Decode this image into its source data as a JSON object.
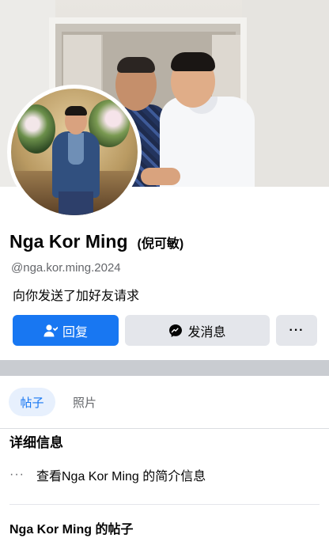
{
  "profile": {
    "name": "Nga Kor Ming",
    "alt_name": "(倪可敏)",
    "handle": "@nga.kor.ming.2024",
    "friend_request_text": "向你发送了加好友请求"
  },
  "actions": {
    "reply_label": "回复",
    "message_label": "发消息",
    "more_label": "···"
  },
  "tabs": [
    {
      "label": "帖子",
      "active": true
    },
    {
      "label": "照片",
      "active": false
    }
  ],
  "details": {
    "title": "详细信息",
    "intro_dots": "···",
    "intro_text": "查看Nga Kor Ming 的简介信息"
  },
  "posts_section": {
    "title": "Nga Kor Ming 的帖子"
  },
  "colors": {
    "primary": "#1877f2",
    "button_gray": "#e4e6eb",
    "active_tab_bg": "#e7f0fd"
  },
  "icons": {
    "reply": "add-friend-person-icon",
    "message": "messenger-icon",
    "more": "more-dots-icon"
  }
}
